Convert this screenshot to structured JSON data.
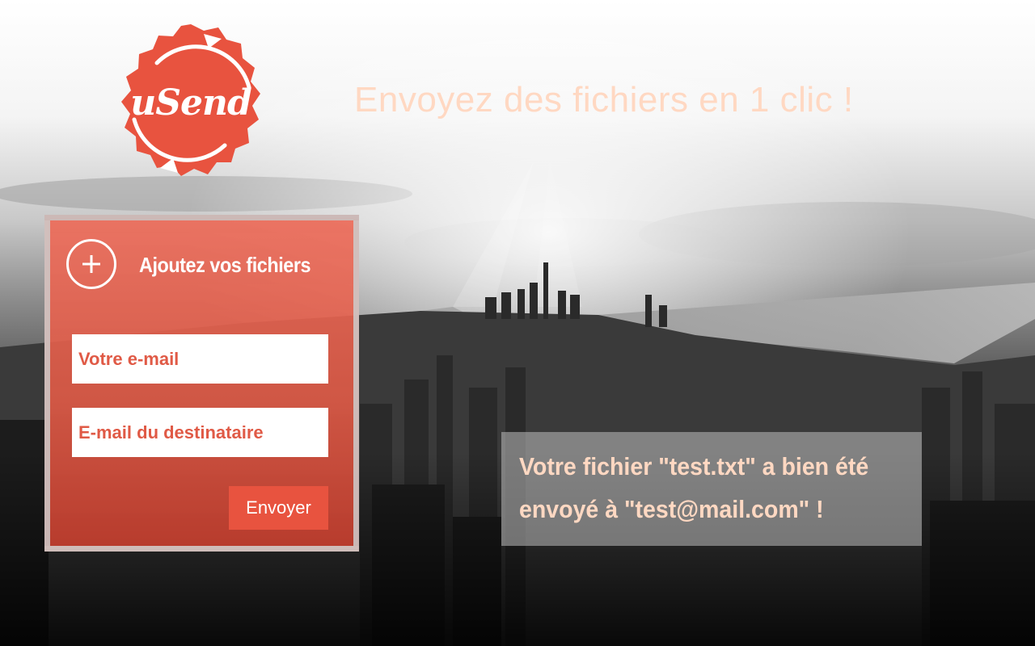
{
  "brand": {
    "logo_text": "uSend"
  },
  "header": {
    "tagline": "Envoyez des fichiers en 1 clic !"
  },
  "upload": {
    "add_label": "Ajoutez vos fichiers",
    "email_placeholder": "Votre e-mail",
    "recipient_placeholder": "E-mail du destinataire",
    "send_label": "Envoyer"
  },
  "notification": {
    "message": "Votre fichier \"test.txt\" a bien été envoyé à \"test@mail.com\" !"
  },
  "colors": {
    "accent": "#e8533f",
    "tagline": "#ffd8c2",
    "panel_border": "#cdcdcd"
  },
  "icons": {
    "add": "plus-icon",
    "logo_arrows": "circular-arrows-icon"
  }
}
